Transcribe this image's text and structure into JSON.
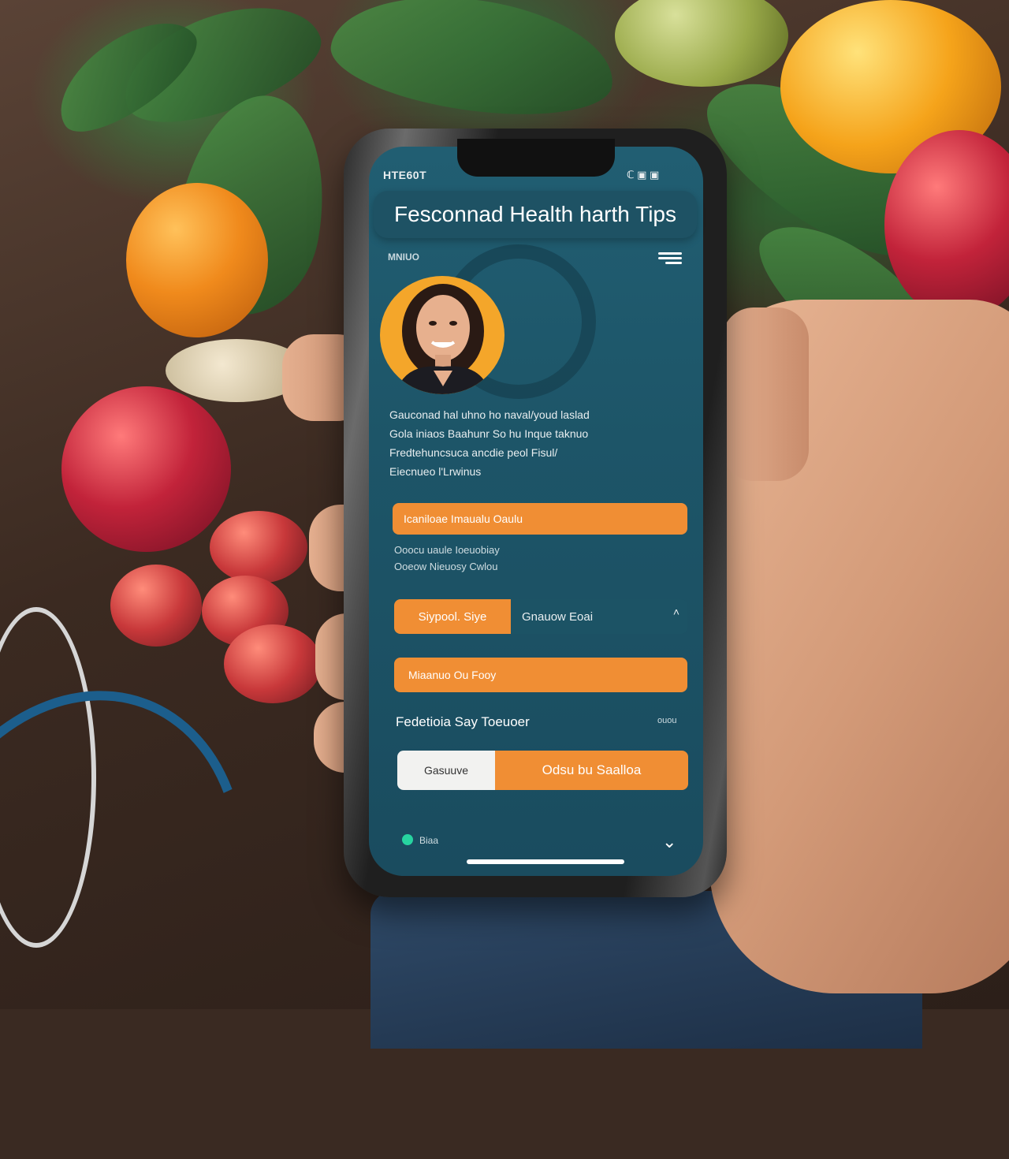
{
  "status_bar": {
    "time": "HTE60T",
    "icons": "ℂ ▣ ▣"
  },
  "app": {
    "title": "Fesconnad Health harth Tips",
    "top_label": "MNIUO",
    "description_lines": [
      "Gauconad hal uhno ho naval/youd laslad",
      "Gola iniaos Baahunr So hu Inque taknuo",
      "Fredtehuncsuca ancdie peol Fisul/",
      "Eiecnueo l'Lrwinus"
    ],
    "primary_button": "Icaniloae Imaualu Oaulu",
    "sub_lines": [
      "Ooocu uaule Ioeuobiay",
      "Ooeow Nieuosy Cwlou"
    ],
    "segment": {
      "left": "Siypool. Siye",
      "right": "Gnauow Eoai"
    },
    "secondary_button": "Miaanuo Ou Fooy",
    "section": {
      "title": "Fedetioia Say Toeuoer",
      "aside": "ouou"
    },
    "split_button": {
      "left": "Gasuuve",
      "right": "Odsu bu Saalloa"
    },
    "footer_label": "Biaa"
  },
  "colors": {
    "accent": "#f08e34",
    "screen": "#1d5568",
    "indicator": "#27d4a0"
  },
  "icons": [
    "menu-icon",
    "chevron-up-icon",
    "chevron-down-icon"
  ]
}
